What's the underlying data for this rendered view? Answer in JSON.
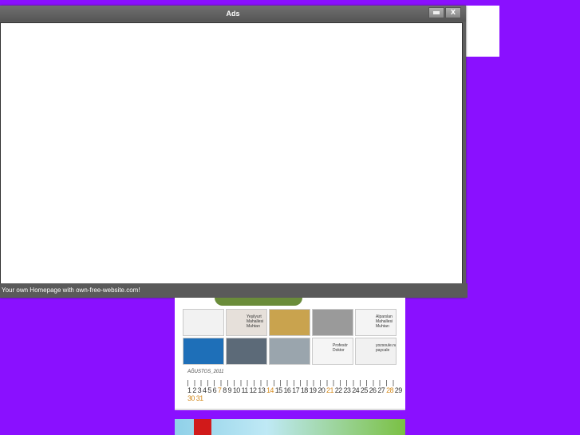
{
  "ad_window": {
    "title": "Ads",
    "footer_text": "Your own Homepage with own-free-website.com!",
    "close_label": "X"
  },
  "banner": {
    "cells": [
      {
        "name": "keys-ad",
        "text": ""
      },
      {
        "name": "muhtar-ad-1",
        "text": "Yeşilyurt Mahallesi Muhtarı"
      },
      {
        "name": "honey-ad",
        "text": ""
      },
      {
        "name": "tools-ad",
        "text": ""
      },
      {
        "name": "muhtar-ad-2",
        "text": "Alparslan Mahallesi Muhtarı"
      },
      {
        "name": "logo-ad",
        "text": ""
      },
      {
        "name": "building-ad",
        "text": ""
      },
      {
        "name": "construction-ad",
        "text": ""
      },
      {
        "name": "person-ad",
        "text": "Profesör Doktor"
      },
      {
        "name": "food-ad",
        "text": "yozsoule.na paycale"
      }
    ],
    "calendar_title": "AĞUSTOS_2011",
    "calendar_days": [
      "1",
      "2",
      "3",
      "4",
      "5",
      "6",
      "7",
      "8",
      "9",
      "10",
      "11",
      "12",
      "13",
      "14",
      "15",
      "16",
      "17",
      "18",
      "19",
      "20",
      "21",
      "22",
      "23",
      "24",
      "25",
      "26",
      "27",
      "28",
      "29",
      "30",
      "31"
    ],
    "highlight_days": [
      "7",
      "14",
      "21",
      "28",
      "30",
      "31"
    ]
  }
}
